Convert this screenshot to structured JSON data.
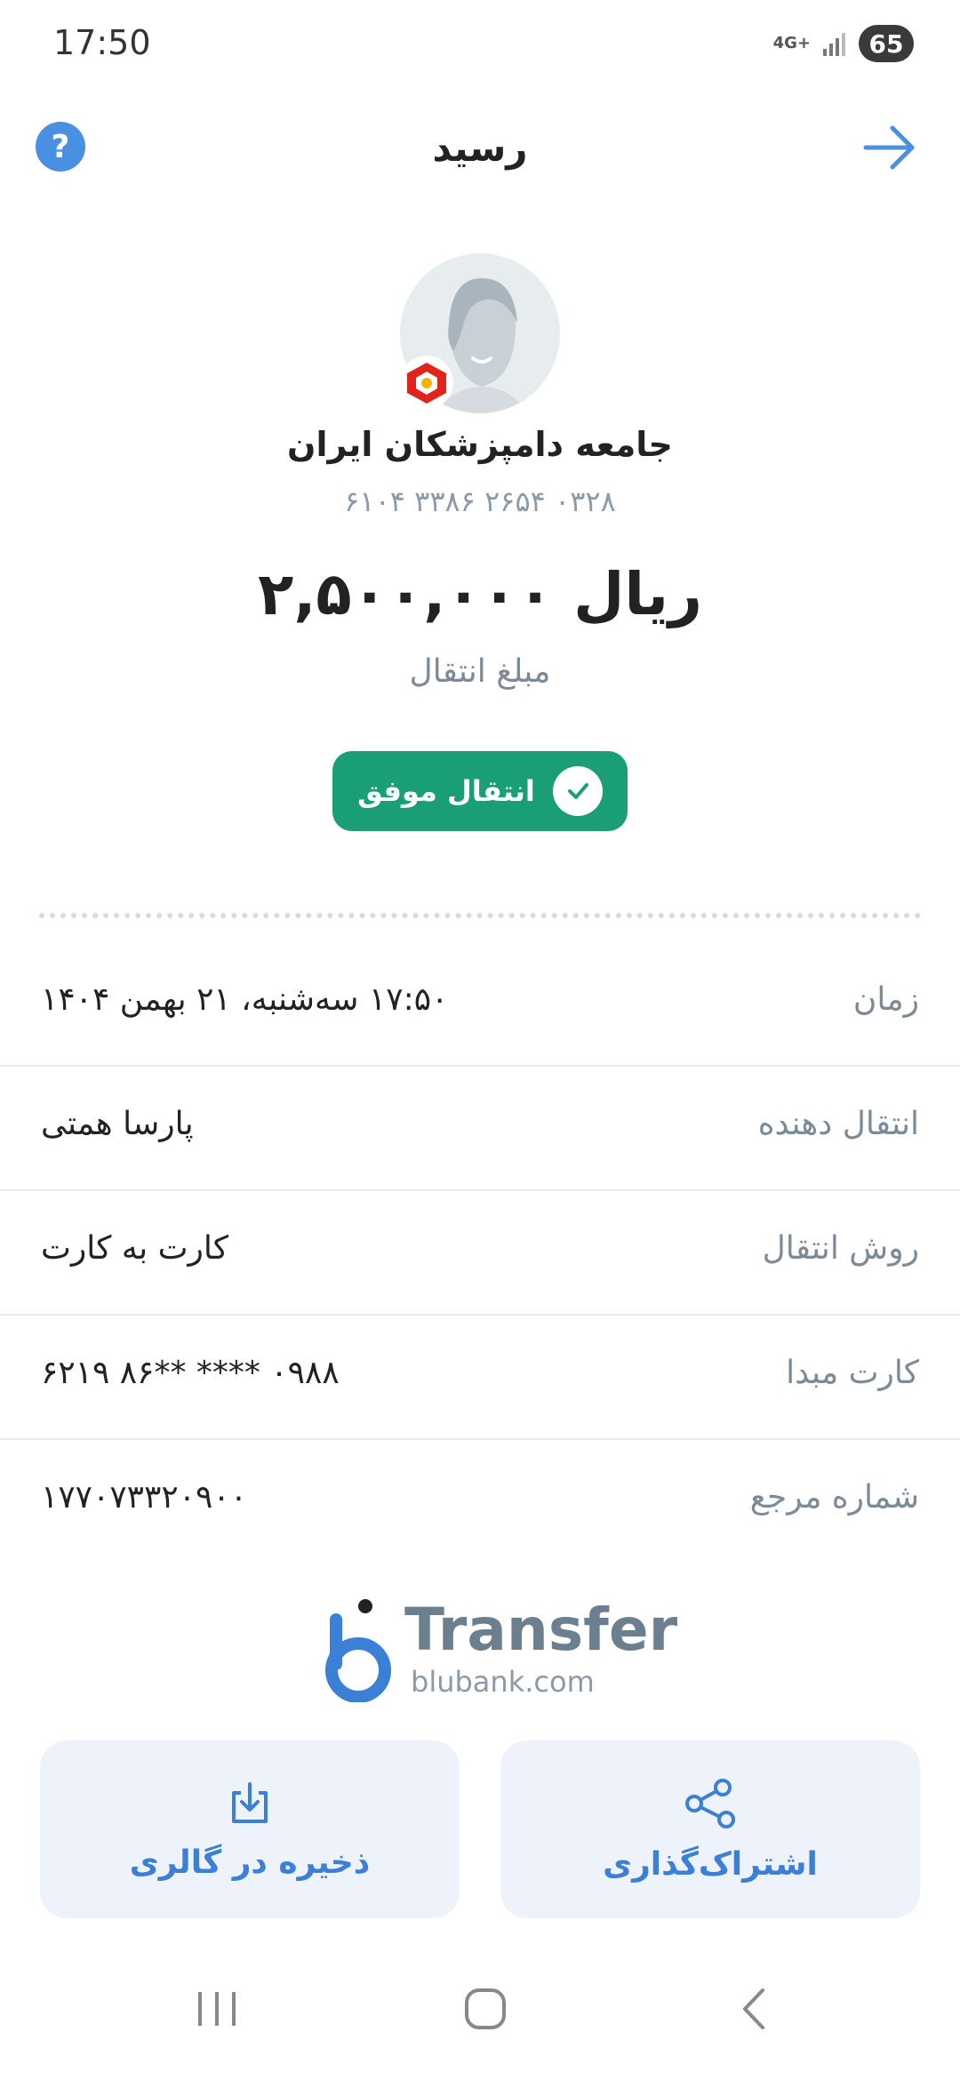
{
  "status_bar": {
    "time": "17:50",
    "network": "4G+",
    "battery": "65"
  },
  "header": {
    "title": "رسید",
    "help_icon": "help-icon",
    "back_icon": "arrow-right-icon"
  },
  "recipient": {
    "name": "جامعه دامپزشکان ایران",
    "card_number": "۶۱۰۴ ۳۳۸۶ ۲۶۵۴ ۰۳۲۸",
    "bank_icon": "bank-logo-icon"
  },
  "transaction": {
    "amount": "۲,۵۰۰,۰۰۰ ریال",
    "amount_label": "مبلغ انتقال",
    "status": "انتقال موفق"
  },
  "details": [
    {
      "label": "زمان",
      "value": "۱۷:۵۰ سه‌شنبه، ۲۱ بهمن ۱۴۰۴"
    },
    {
      "label": "انتقال دهنده",
      "value": "پارسا همتی"
    },
    {
      "label": "روش انتقال",
      "value": "کارت به کارت"
    },
    {
      "label": "کارت مبدا",
      "value": "۶۲۱۹ ۸۶** **** ۰۹۸۸"
    },
    {
      "label": "شماره مرجع",
      "value": "۱۷۷۰۷۳۳۲۰۹۰۰"
    }
  ],
  "logo": {
    "title": "Transfer",
    "subtitle": "blubank.com"
  },
  "actions": {
    "save": {
      "label": "ذخیره در گالری",
      "icon": "download-icon"
    },
    "share": {
      "label": "اشتراک‌گذاری",
      "icon": "share-icon"
    }
  },
  "colors": {
    "accent": "#3b7fd6",
    "success": "#1a9e76",
    "muted": "#7b8a97"
  }
}
